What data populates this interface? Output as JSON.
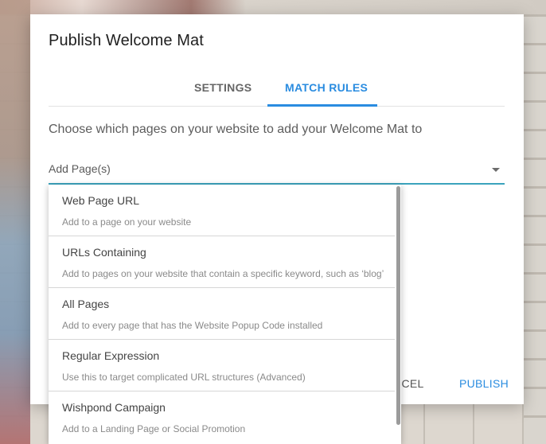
{
  "dialog": {
    "title": "Publish Welcome Mat",
    "tabs": [
      {
        "label": "SETTINGS",
        "active": false
      },
      {
        "label": "MATCH RULES",
        "active": true
      }
    ],
    "instructions": "Choose which pages on your website to add your Welcome Mat to",
    "select": {
      "placeholder": "Add Page(s)"
    },
    "footer": {
      "cancel_label": "CANCEL",
      "publish_label": "PUBLISH"
    }
  },
  "menu": {
    "items": [
      {
        "title": "Web Page URL",
        "description": "Add to a page on your website"
      },
      {
        "title": "URLs Containing",
        "description": "Add to pages on your website that contain a specific keyword, such as ‘blog’"
      },
      {
        "title": "All Pages",
        "description": "Add to every page that has the Website Popup Code installed"
      },
      {
        "title": "Regular Expression",
        "description": "Use this to target complicated URL structures (Advanced)"
      },
      {
        "title": "Wishpond Campaign",
        "description": "Add to a Landing Page or Social Promotion"
      }
    ]
  },
  "colors": {
    "accent": "#2a8ce0",
    "input_underline": "#3ba3bd"
  }
}
